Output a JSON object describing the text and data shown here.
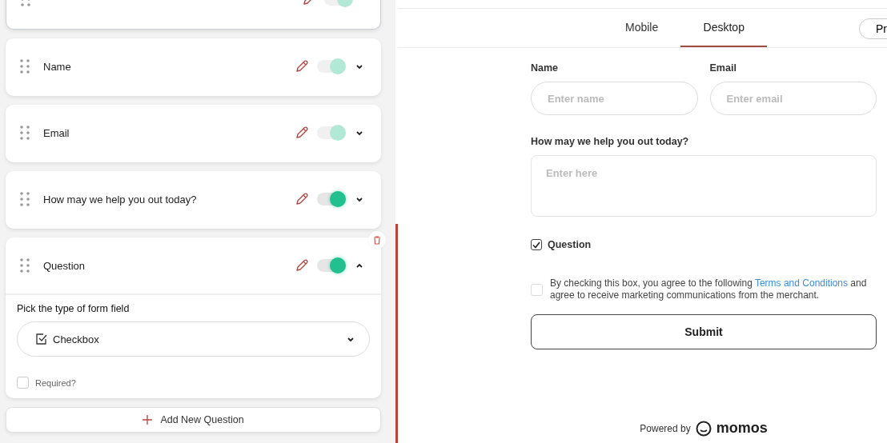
{
  "questions": [
    {
      "kind": "partial",
      "on": true,
      "disabled": true
    },
    {
      "label": "Name",
      "kind": "plain",
      "on": true,
      "disabled": true,
      "expanded": false
    },
    {
      "label": "Email",
      "kind": "plain",
      "on": true,
      "disabled": true,
      "expanded": false
    },
    {
      "label": "How may we help you out today?",
      "kind": "plain",
      "on": true,
      "disabled": false,
      "expanded": false
    },
    {
      "label": "Question",
      "kind": "plain",
      "on": true,
      "disabled": false,
      "expanded": true,
      "editor": {
        "heading": "Pick the type of form field",
        "field_type": "Checkbox",
        "required_label": "Required?",
        "required": false
      }
    }
  ],
  "add_button": "Add New Question",
  "tabs": [
    {
      "label": "Mobile",
      "selected": false
    },
    {
      "label": "Desktop",
      "selected": true
    }
  ],
  "preview_button": "Pr",
  "form": {
    "name_label": "Name",
    "name_placeholder": "Enter name",
    "email_label": "Email",
    "email_placeholder": "Enter email",
    "help_label": "How may we help you out today?",
    "help_placeholder": "Enter here",
    "question_label": "Question",
    "question_checked": true,
    "consent_before": "By checking this box, you agree to the following",
    "consent_link": "Terms and Conditions",
    "consent_after": "and agree to receive marketing communications from the merchant.",
    "consent_checked": false,
    "submit": "Submit"
  },
  "footer": {
    "powered": "Powered by",
    "brand": "momos"
  }
}
